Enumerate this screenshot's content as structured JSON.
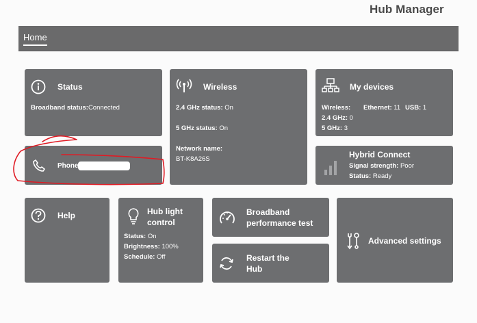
{
  "header": {
    "app_title": "Hub Manager"
  },
  "nav": {
    "home_tab": "Home"
  },
  "status_tile": {
    "title": "Status",
    "broadband_label": "Broadband status:",
    "broadband_value": "Connected"
  },
  "phone_tile": {
    "label": "Phone"
  },
  "wireless_tile": {
    "title": "Wireless",
    "ghz24_label": "2.4 GHz status:",
    "ghz24_value": "On",
    "ghz5_label": "5 GHz status:",
    "ghz5_value": "On",
    "network_label": "Network name:",
    "network_value": "BT-K8A26S"
  },
  "devices_tile": {
    "title": "My devices",
    "wireless_label": "Wireless:",
    "ethernet_label": "Ethernet:",
    "ethernet_value": "11",
    "usb_label": "USB:",
    "usb_value": "1",
    "ghz24_label": "2.4 GHz:",
    "ghz24_value": "0",
    "ghz5_label": "5 GHz:",
    "ghz5_value": "3"
  },
  "hybrid_tile": {
    "title": "Hybrid Connect",
    "signal_label": "Signal strength:",
    "signal_value": "Poor",
    "status_label": "Status:",
    "status_value": "Ready"
  },
  "help_tile": {
    "title": "Help"
  },
  "hublight_tile": {
    "title_line1": "Hub light",
    "title_line2": "control",
    "status_label": "Status:",
    "status_value": "On",
    "brightness_label": "Brightness:",
    "brightness_value": "100%",
    "schedule_label": "Schedule:",
    "schedule_value": "Off"
  },
  "perf_tile": {
    "title_line1": "Broadband",
    "title_line2": "performance test"
  },
  "restart_tile": {
    "title_line1": "Restart the",
    "title_line2": "Hub"
  },
  "advanced_tile": {
    "title": "Advanced settings"
  },
  "icons": {
    "status": "info-icon",
    "wireless": "antenna-icon",
    "devices": "network-devices-icon",
    "phone": "phone-icon",
    "hybrid": "signal-bars-icon",
    "help": "help-icon",
    "hublight": "lightbulb-icon",
    "perf": "speedometer-icon",
    "restart": "restart-icon",
    "advanced": "tools-icon"
  },
  "colors": {
    "tile": "#6d6e70",
    "nav": "#6a6a6b",
    "background": "#fbfbfb",
    "annotation": "#e01b24"
  }
}
